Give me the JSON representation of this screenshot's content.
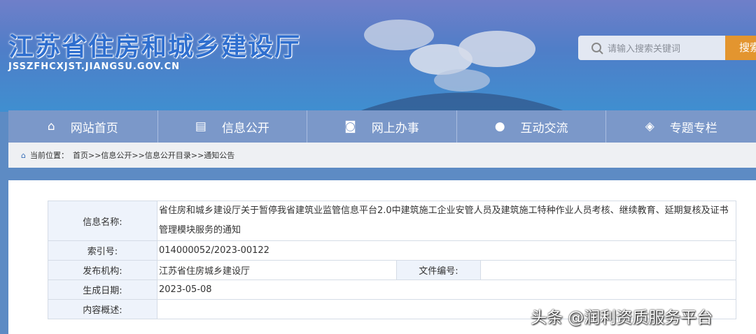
{
  "header": {
    "title": "江苏省住房和城乡建设厅",
    "domain": "JSSZFHCXJST.JIANGSU.GOV.CN",
    "search_placeholder": "请输入搜索关键词",
    "search_button": "搜索"
  },
  "nav": [
    {
      "label": "网站首页",
      "icon": "home-icon"
    },
    {
      "label": "信息公开",
      "icon": "document-icon"
    },
    {
      "label": "网上办事",
      "icon": "search-doc-icon"
    },
    {
      "label": "互动交流",
      "icon": "chat-icon"
    },
    {
      "label": "专题专栏",
      "icon": "layers-icon"
    }
  ],
  "breadcrumb": {
    "prefix": "当前位置：",
    "path": "首页>>信息公开>>信息公开目录>>通知公告"
  },
  "info": {
    "name_label": "信息名称:",
    "name_value": "省住房和城乡建设厅关于暂停我省建筑业监管信息平台2.0中建筑施工企业安管人员及建筑施工特种作业人员考核、继续教育、延期复核及证书管理模块服务的通知",
    "index_label": "索引号:",
    "index_value": "014000052/2023-00122",
    "org_label": "发布机构:",
    "org_value": "江苏省住房城乡建设厅",
    "docno_label": "文件编号:",
    "docno_value": "",
    "date_label": "生成日期:",
    "date_value": "2023-05-08",
    "summary_label": "内容概述:",
    "summary_value": ""
  },
  "watermark": "头条 @润利资质服务平台"
}
